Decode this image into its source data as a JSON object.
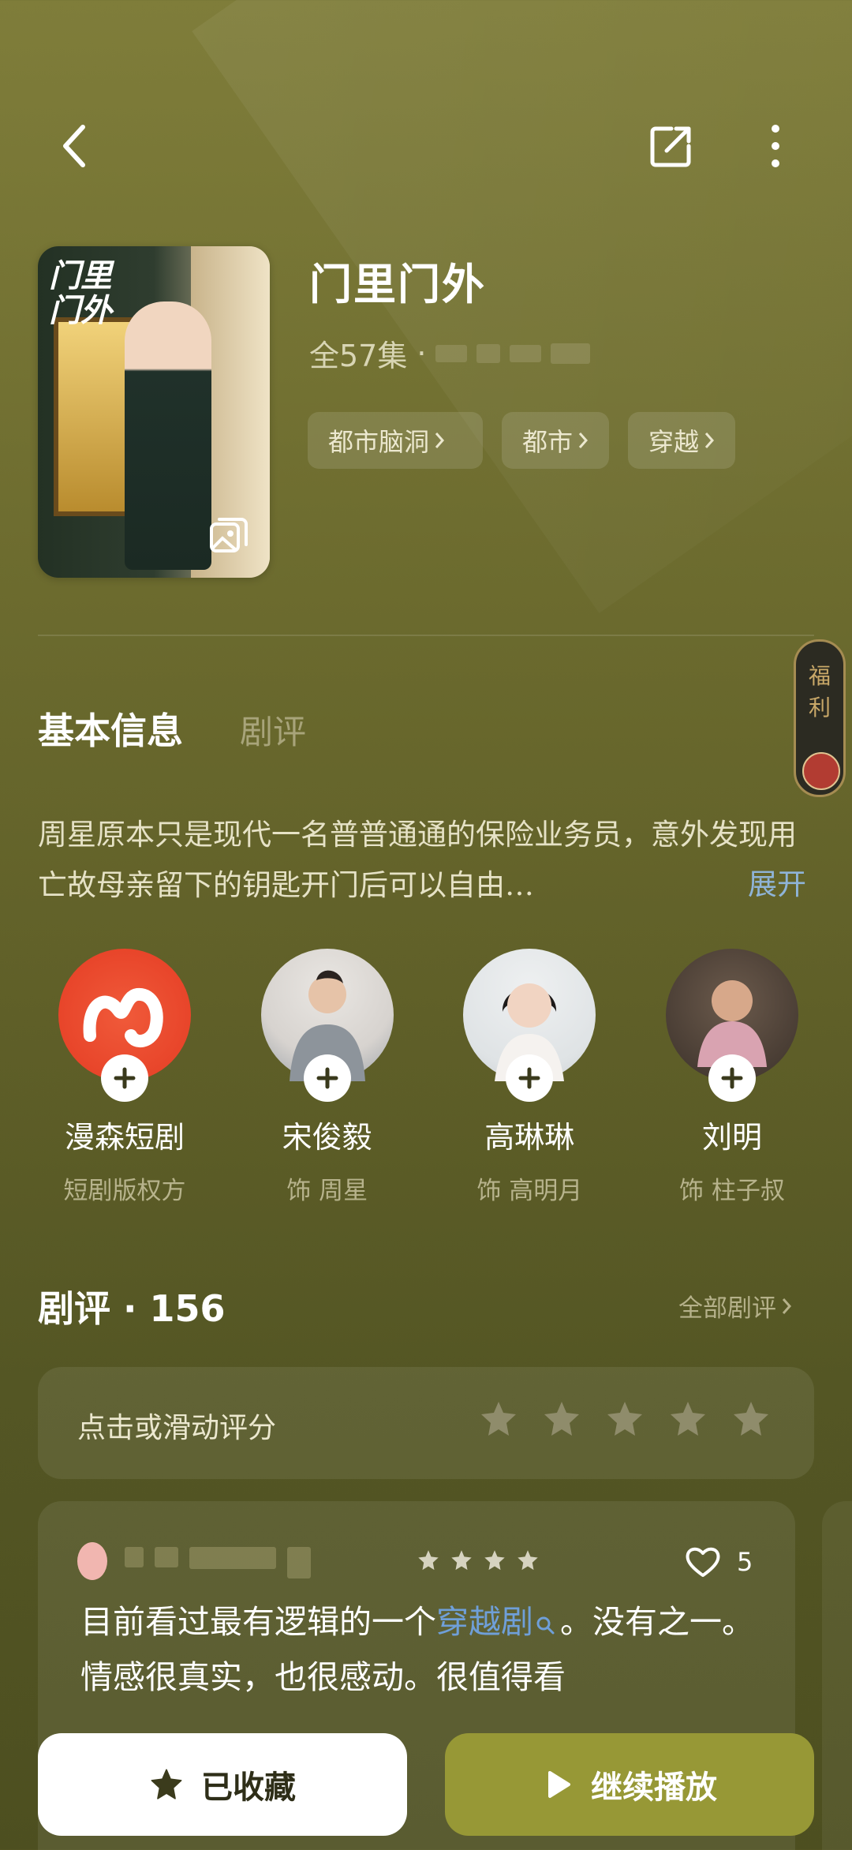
{
  "header": {
    "back_icon": "chevron-left-icon",
    "share_icon": "share-icon",
    "more_icon": "more-vertical-icon"
  },
  "drama": {
    "cover_title": "门里门外",
    "title": "门里门外",
    "episodes": "全57集",
    "separator": "·",
    "tags": [
      {
        "label": "都市脑洞"
      },
      {
        "label": "都市"
      },
      {
        "label": "穿越"
      }
    ]
  },
  "side_badge": {
    "label": "福利"
  },
  "tabs": [
    {
      "label": "基本信息",
      "active": true
    },
    {
      "label": "剧评",
      "active": false
    }
  ],
  "description": {
    "text": "周星原本只是现代一名普普通通的保险业务员，意外发现用亡故母亲留下的钥匙开门后可以自由…",
    "expand_label": "展开"
  },
  "cast": [
    {
      "name": "漫森短剧",
      "role": "短剧版权方"
    },
    {
      "name": "宋俊毅",
      "role": "饰 周星"
    },
    {
      "name": "高琳琳",
      "role": "饰 高明月"
    },
    {
      "name": "刘明",
      "role": "饰 柱子叔"
    }
  ],
  "reviews": {
    "heading": "剧评 · 156",
    "all_label": "全部剧评",
    "rate_prompt": "点击或滑动评分",
    "first_review": {
      "likes": "5",
      "text_before": "目前看过最有逻辑的一个",
      "link_text": "穿越剧",
      "text_after": "。没有之一。情感很真实，也很感动。很值得看"
    }
  },
  "bottom_bar": {
    "favorite_label": "已收藏",
    "play_label": "继续播放"
  },
  "colors": {
    "background": "#6d6c2f",
    "play_button": "#979836",
    "link": "#6f9fd8"
  }
}
